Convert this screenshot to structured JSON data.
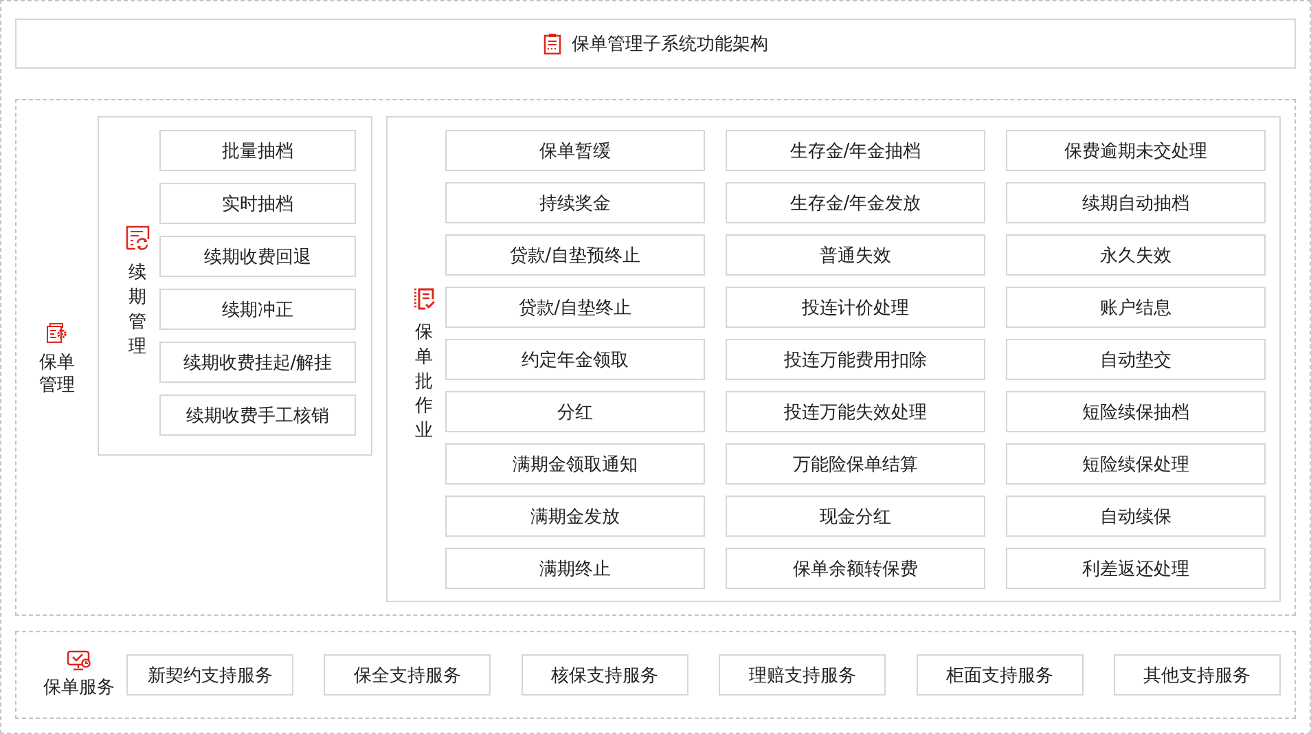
{
  "title": "保单管理子系统功能架构",
  "management": {
    "label": "保单管理"
  },
  "renewal": {
    "label": "续期管理",
    "items": [
      "批量抽档",
      "实时抽档",
      "续期收费回退",
      "续期冲正",
      "续期收费挂起/解挂",
      "续期收费手工核销"
    ]
  },
  "batch": {
    "label": "保单批作业",
    "items": [
      "保单暂缓",
      "生存金/年金抽档",
      "保费逾期未交处理",
      "持续奖金",
      "生存金/年金发放",
      "续期自动抽档",
      "贷款/自垫预终止",
      "普通失效",
      "永久失效",
      "贷款/自垫终止",
      "投连计价处理",
      "账户结息",
      "约定年金领取",
      "投连万能费用扣除",
      "自动垫交",
      "分红",
      "投连万能失效处理",
      "短险续保抽档",
      "满期金领取通知",
      "万能险保单结算",
      "短险续保处理",
      "满期金发放",
      "现金分红",
      "自动续保",
      "满期终止",
      "保单余额转保费",
      "利差返还处理"
    ]
  },
  "services": {
    "label": "保单服务",
    "items": [
      "新契约支持服务",
      "保全支持服务",
      "核保支持服务",
      "理赔支持服务",
      "柜面支持服务",
      "其他支持服务"
    ]
  }
}
